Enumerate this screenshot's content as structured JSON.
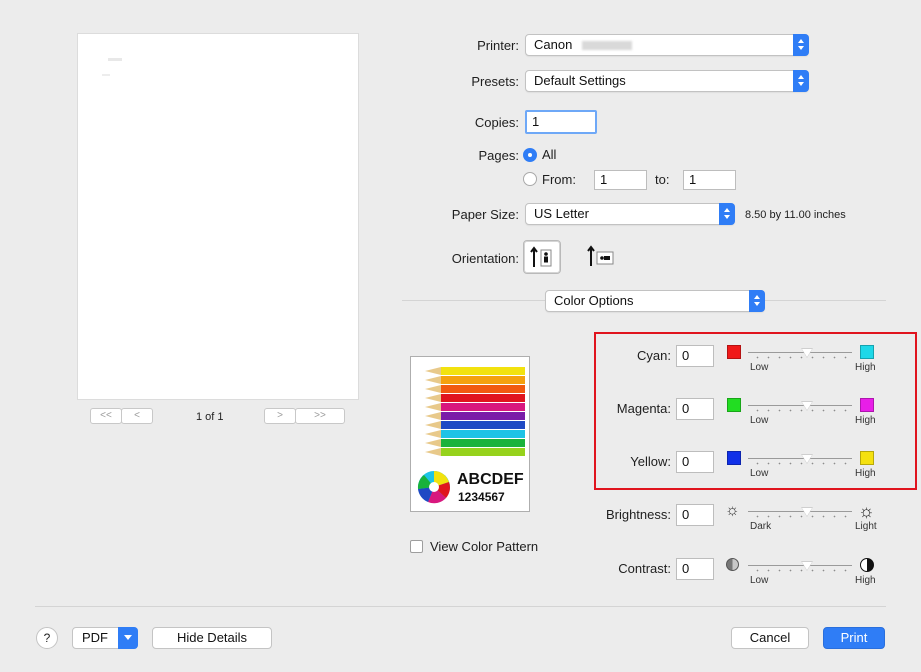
{
  "preview": {
    "page_counter": "1 of 1",
    "first_page": "<<",
    "prev_page": "<",
    "next_page": ">",
    "last_page": ">>"
  },
  "printer": {
    "label": "Printer:",
    "value": "Canon"
  },
  "presets": {
    "label": "Presets:",
    "value": "Default Settings"
  },
  "copies": {
    "label": "Copies:",
    "value": "1"
  },
  "pages": {
    "label": "Pages:",
    "all_label": "All",
    "from_label": "From:",
    "from_value": "1",
    "to_label": "to:",
    "to_value": "1",
    "selected": "All"
  },
  "paper_size": {
    "label": "Paper Size:",
    "value": "US Letter",
    "dimensions": "8.50 by 11.00 inches"
  },
  "orientation": {
    "label": "Orientation:",
    "selected": "portrait"
  },
  "section": {
    "value": "Color Options"
  },
  "color_sample": {
    "text_line1": "ABCDEF",
    "text_line2": "1234567"
  },
  "view_pattern": {
    "label": "View Color Pattern",
    "checked": false
  },
  "sliders": [
    {
      "label": "Cyan:",
      "value": "0",
      "low": "Low",
      "high": "High",
      "low_color": "#f01919",
      "high_color": "#1ed8e8",
      "low_icon": "red-swatch-icon",
      "high_icon": "cyan-swatch-icon"
    },
    {
      "label": "Magenta:",
      "value": "0",
      "low": "Low",
      "high": "High",
      "low_color": "#22dd22",
      "high_color": "#e81ee8",
      "low_icon": "green-swatch-icon",
      "high_icon": "magenta-swatch-icon"
    },
    {
      "label": "Yellow:",
      "value": "0",
      "low": "Low",
      "high": "High",
      "low_color": "#1030e8",
      "high_color": "#f5e10f",
      "low_icon": "blue-swatch-icon",
      "high_icon": "yellow-swatch-icon"
    },
    {
      "label": "Brightness:",
      "value": "0",
      "low": "Dark",
      "high": "Light",
      "low_icon": "sun-dim-icon",
      "high_icon": "sun-bright-icon"
    },
    {
      "label": "Contrast:",
      "value": "0",
      "low": "Low",
      "high": "High",
      "low_icon": "contrast-low-icon",
      "high_icon": "contrast-high-icon"
    }
  ],
  "footer": {
    "help": "?",
    "pdf": "PDF",
    "hide_details": "Hide Details",
    "cancel": "Cancel",
    "print": "Print"
  },
  "colors": {
    "accent": "#2f7df6",
    "highlight_box": "#e0141e"
  }
}
